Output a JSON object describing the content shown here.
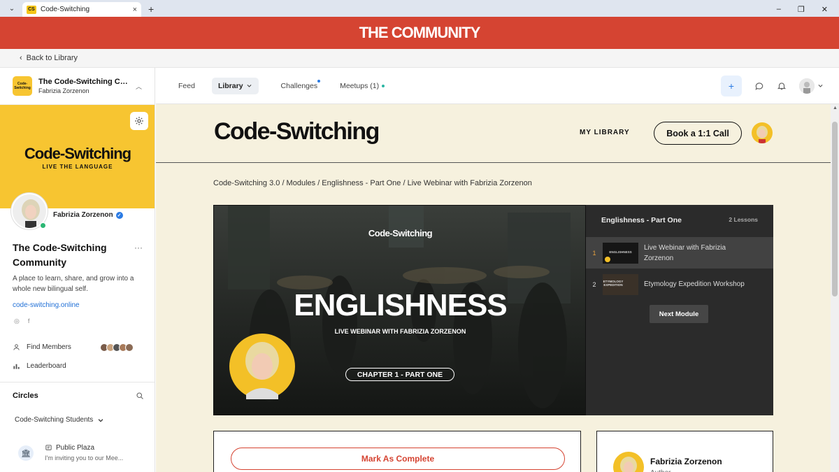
{
  "browser": {
    "tab_favicon": "CS",
    "tab_title": "Code-Switching",
    "tab_close": "×",
    "new_tab": "+",
    "min": "–",
    "restore": "❐",
    "close": "✕"
  },
  "banner": {
    "title": "THE COMMUNITY"
  },
  "back": {
    "label": "Back to Library"
  },
  "sidebar": {
    "community_short": "The Code-Switching Co...",
    "owner_small": "Fabrizia Zorzenon",
    "logo_text": "Code-Switching",
    "cover_title": "Code-Switching",
    "cover_tagline": "LIVE THE LANGUAGE",
    "owner_name": "Fabrizia Zorzenon",
    "community_name": "The Code-Switching Community",
    "more": "···",
    "description": "A place to learn, share, and grow into a whole new bilingual self.",
    "website": "code-switching.online",
    "social_instagram": "◎",
    "social_facebook": "f",
    "find_members": "Find Members",
    "leaderboard": "Leaderboard",
    "circles_title": "Circles",
    "circle_group": "Code-Switching Students",
    "plaza_name": "Public Plaza",
    "plaza_message": "I'm inviting you to our Mee..."
  },
  "nav": {
    "feed": "Feed",
    "library": "Library",
    "challenges": "Challenges",
    "meetups": "Meetups (1)"
  },
  "header": {
    "brand": "Code-Switching",
    "my_library": "MY LIBRARY",
    "call_button": "Book a 1:1 Call"
  },
  "breadcrumb": "Code-Switching 3.0 / Modules / Englishness - Part One / Live Webinar with Fabrizia Zorzenon",
  "video": {
    "brand": "Code-Switching",
    "title": "ENGLISHNESS",
    "subtitle": "LIVE WEBINAR WITH FABRIZIA ZORZENON",
    "chapter": "CHAPTER 1 - PART ONE"
  },
  "lessons": {
    "module_title": "Englishness - Part One",
    "count": "2 Lessons",
    "items": [
      {
        "num": "1",
        "title": "Live Webinar with Fabrizia Zorzenon",
        "thumb_text": "ENGLISHNESS"
      },
      {
        "num": "2",
        "title": "Etymology Expedition Workshop",
        "thumb_text": "ETYMOLOGY EXPEDITION"
      }
    ],
    "next_button": "Next Module"
  },
  "actions": {
    "mark_complete": "Mark As Complete"
  },
  "author": {
    "name": "Fabrizia Zorzenon",
    "role": "Author"
  },
  "colors": {
    "banner": "#d54432",
    "accent_yellow": "#f7c531",
    "page_bg": "#f6f1de",
    "link": "#1f6fd6"
  }
}
